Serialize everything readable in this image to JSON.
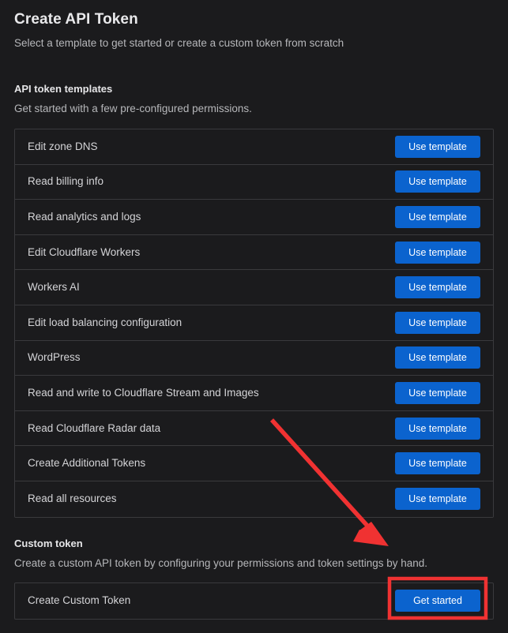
{
  "header": {
    "title": "Create API Token",
    "subtitle": "Select a template to get started or create a custom token from scratch"
  },
  "templates_section": {
    "heading": "API token templates",
    "description": "Get started with a few pre-configured permissions.",
    "button_label": "Use template",
    "items": [
      {
        "label": "Edit zone DNS"
      },
      {
        "label": "Read billing info"
      },
      {
        "label": "Read analytics and logs"
      },
      {
        "label": "Edit Cloudflare Workers"
      },
      {
        "label": "Workers AI"
      },
      {
        "label": "Edit load balancing configuration"
      },
      {
        "label": "WordPress"
      },
      {
        "label": "Read and write to Cloudflare Stream and Images"
      },
      {
        "label": "Read Cloudflare Radar data"
      },
      {
        "label": "Create Additional Tokens"
      },
      {
        "label": "Read all resources"
      }
    ]
  },
  "custom_section": {
    "heading": "Custom token",
    "description": "Create a custom API token by configuring your permissions and token settings by hand.",
    "row_label": "Create Custom Token",
    "button_label": "Get started"
  },
  "annotation": {
    "arrow_color": "#f03232",
    "highlight_color": "#f03232",
    "target": "get-started-button"
  },
  "colors": {
    "background": "#1b1b1d",
    "border": "#3a3a3d",
    "accent_blue": "#0b63ce",
    "text_primary": "#e6e6e8",
    "text_secondary": "#b6b7ba"
  }
}
